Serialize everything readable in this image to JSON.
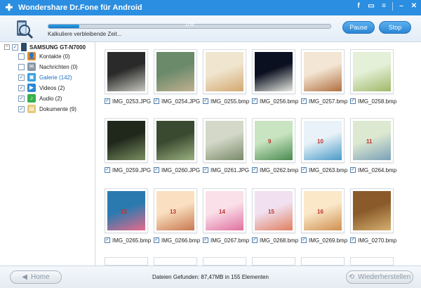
{
  "titlebar": {
    "title": "Wondershare Dr.Fone für Android"
  },
  "progress": {
    "percent_label": "11%",
    "fraction": 0.11,
    "label": "Kalkuliere verbleibende Zeit...",
    "pause_label": "Pause",
    "stop_label": "Stop"
  },
  "sidebar": {
    "device": {
      "label": "SAMSUNG GT-N7000"
    },
    "items": [
      {
        "label": "Kontakte (0)",
        "icon": "contacts-icon",
        "color": "#e08a2a"
      },
      {
        "label": "Nachrichten (0)",
        "icon": "messages-icon",
        "color": "#7a8a9a"
      },
      {
        "label": "Galerie (142)",
        "icon": "gallery-icon",
        "color": "#3aa0e0"
      },
      {
        "label": "Videos (2)",
        "icon": "videos-icon",
        "color": "#2b86d4"
      },
      {
        "label": "Audio (2)",
        "icon": "audio-icon",
        "color": "#3ab04a"
      },
      {
        "label": "Dokumente (9)",
        "icon": "documents-icon",
        "color": "#e6c87a"
      }
    ]
  },
  "grid": {
    "files": [
      {
        "name": "IMG_0253.JPG"
      },
      {
        "name": "IMG_0254.JPG"
      },
      {
        "name": "IMG_0255.bmp"
      },
      {
        "name": "IMG_0256.bmp"
      },
      {
        "name": "IMG_0257.bmp"
      },
      {
        "name": "IMG_0258.bmp"
      },
      {
        "name": "IMG_0259.JPG"
      },
      {
        "name": "IMG_0260.JPG"
      },
      {
        "name": "IMG_0261.JPG"
      },
      {
        "name": "IMG_0262.bmp",
        "num": "9"
      },
      {
        "name": "IMG_0263.bmp",
        "num": "10"
      },
      {
        "name": "IMG_0264.bmp",
        "num": "11"
      },
      {
        "name": "IMG_0265.bmp",
        "num": "12"
      },
      {
        "name": "IMG_0266.bmp",
        "num": "13"
      },
      {
        "name": "IMG_0267.bmp",
        "num": "14"
      },
      {
        "name": "IMG_0268.bmp",
        "num": "15"
      },
      {
        "name": "IMG_0269.bmp",
        "num": "16"
      },
      {
        "name": "IMG_0270.bmp"
      }
    ]
  },
  "footer": {
    "home_label": "Home",
    "status": "Dateien Gefunden: 87,47MB in 155 Elementen",
    "restore_label": "Wiederherstellen"
  }
}
